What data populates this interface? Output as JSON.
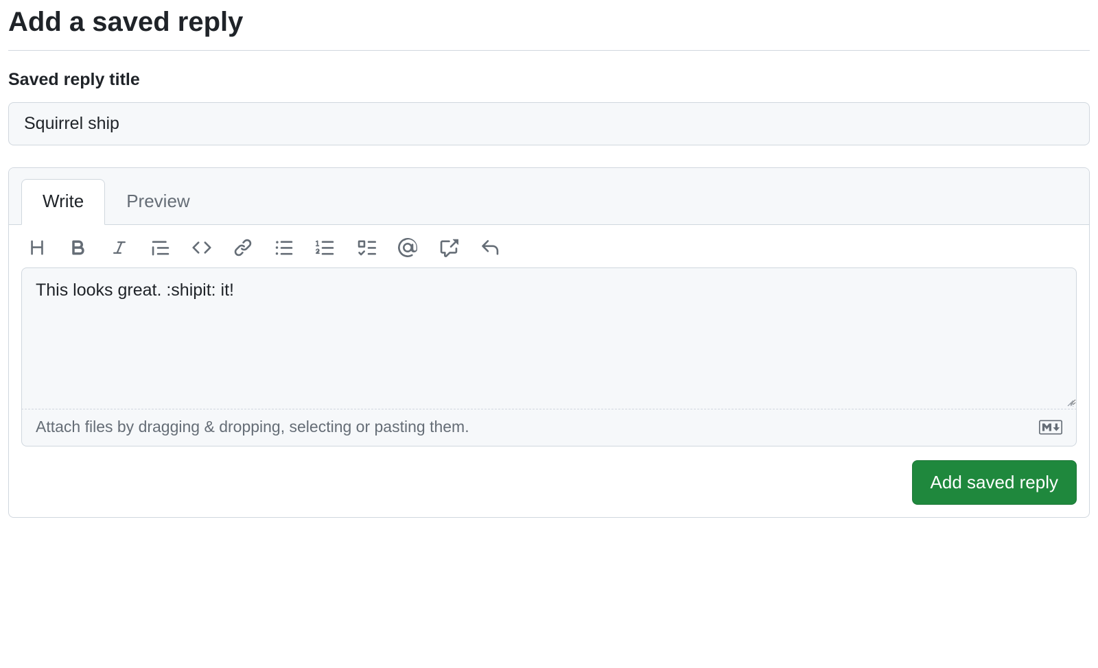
{
  "page": {
    "title": "Add a saved reply"
  },
  "form": {
    "title_label": "Saved reply title",
    "title_value": "Squirrel ship",
    "body_value": "This looks great. :shipit: it!",
    "attach_hint": "Attach files by dragging & dropping, selecting or pasting them."
  },
  "tabs": {
    "write": "Write",
    "preview": "Preview"
  },
  "toolbar": {
    "heading": "Heading",
    "bold": "Bold",
    "italic": "Italic",
    "quote": "Quote",
    "code": "Code",
    "link": "Link",
    "ul": "Unordered list",
    "ol": "Numbered list",
    "tasklist": "Task list",
    "mention": "Mention",
    "reference": "Reference",
    "reply": "Saved reply"
  },
  "buttons": {
    "submit": "Add saved reply"
  }
}
